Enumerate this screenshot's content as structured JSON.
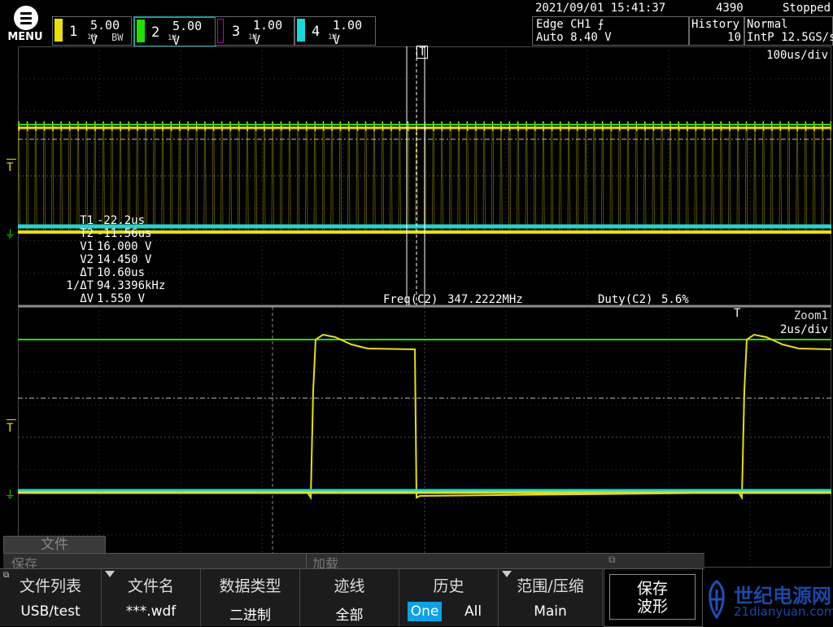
{
  "menu": {
    "label": "MENU"
  },
  "channels": [
    {
      "num": "1",
      "scale": "5.00 V",
      "color": "#e8e000",
      "sub": "1M",
      "bw": "BW"
    },
    {
      "num": "2",
      "scale": "5.00 V",
      "color": "#22e000",
      "sub": "1M",
      "bw": ""
    },
    {
      "num": "3",
      "scale": "1.00 V",
      "color": "#c000c0",
      "sub": "1M",
      "bw": ""
    },
    {
      "num": "4",
      "scale": "1.00 V",
      "color": "#18d8d8",
      "sub": "1M",
      "bw": ""
    }
  ],
  "status": {
    "datetime": "2021/09/01 15:41:37",
    "record_count": "4390",
    "run_state": "Stopped"
  },
  "trigger": {
    "line1": "Edge CH1 ⨍",
    "line2": "Auto 8.40 V"
  },
  "history": {
    "label": "History",
    "value": "10"
  },
  "acquisition": {
    "mode": "Normal",
    "rate": "IntP 12.5GS/s"
  },
  "main_window": {
    "timebase": "100us/div",
    "measurements": [
      {
        "label": "T1",
        "value": "-22.2us"
      },
      {
        "label": "T2",
        "value": "-11.56us"
      },
      {
        "label": "V1",
        "value": "16.000 V"
      },
      {
        "label": "V2",
        "value": "14.450 V"
      },
      {
        "label": "ΔT",
        "value": "10.60us"
      },
      {
        "label": "1/ΔT",
        "value": "94.3396kHz"
      },
      {
        "label": "ΔV",
        "value": "1.550 V"
      }
    ],
    "freq_label": "Freq(C2)",
    "freq_value": "347.2222MHz",
    "duty_label": "Duty(C2)",
    "duty_value": "5.6%"
  },
  "zoom_window": {
    "label": "Zoom1",
    "timebase": "2us/div"
  },
  "marker": {
    "trigger_glyph": "T",
    "level_glyph": "T"
  },
  "softkeys": {
    "file_tab": "文件",
    "save_tab": "保存",
    "load_tab": "加载",
    "items": [
      {
        "title": "文件列表",
        "value": "USB/test"
      },
      {
        "title": "文件名",
        "value": "***.wdf"
      },
      {
        "title": "数据类型",
        "value": "二进制"
      },
      {
        "title": "迹线",
        "value": "全部"
      },
      {
        "title": "历史",
        "one": "One",
        "all": "All"
      },
      {
        "title": "范围/压缩",
        "value": "Main"
      }
    ],
    "save_wave_line1": "保存",
    "save_wave_line2": "波形"
  },
  "watermark": {
    "title": "世纪电源网",
    "url": "21dianyuan.com"
  }
}
